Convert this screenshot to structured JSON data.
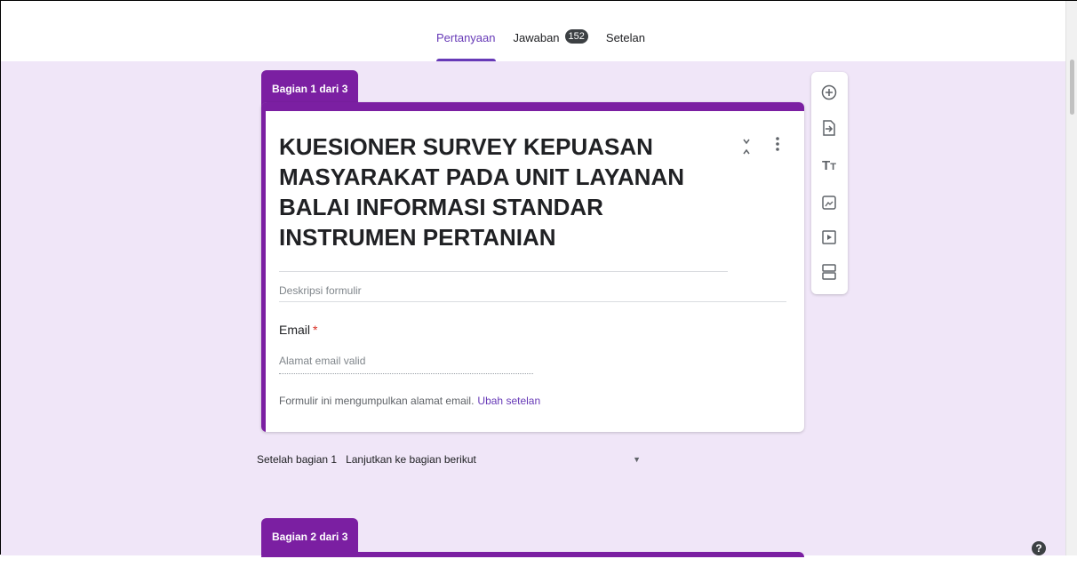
{
  "header": {
    "tabs": [
      {
        "label": "Pertanyaan",
        "active": true
      },
      {
        "label": "Jawaban",
        "badge": "152"
      },
      {
        "label": "Setelan"
      }
    ]
  },
  "section1": {
    "tab_label": "Bagian 1 dari 3",
    "title": "KUESIONER SURVEY KEPUASAN MASYARAKAT PADA UNIT LAYANAN BALAI INFORMASI STANDAR INSTRUMEN PERTANIAN",
    "description_placeholder": "Deskripsi formulir",
    "email_question": {
      "label": "Email",
      "required_mark": "*",
      "placeholder": "Alamat email valid"
    },
    "notice_text": "Formulir ini mengumpulkan alamat email.",
    "notice_link": "Ubah setelan"
  },
  "after_section": {
    "label": "Setelah bagian 1",
    "value": "Lanjutkan ke bagian berikut"
  },
  "section2": {
    "tab_label": "Bagian 2 dari 3"
  },
  "toolbar": {
    "icons": [
      "add-question-icon",
      "import-questions-icon",
      "add-title-icon",
      "add-image-icon",
      "add-video-icon",
      "add-section-icon"
    ]
  },
  "colors": {
    "accent": "#7b1fa2",
    "tab_active": "#673ab7",
    "canvas_bg": "#f0e6f8",
    "required": "#d93025"
  }
}
